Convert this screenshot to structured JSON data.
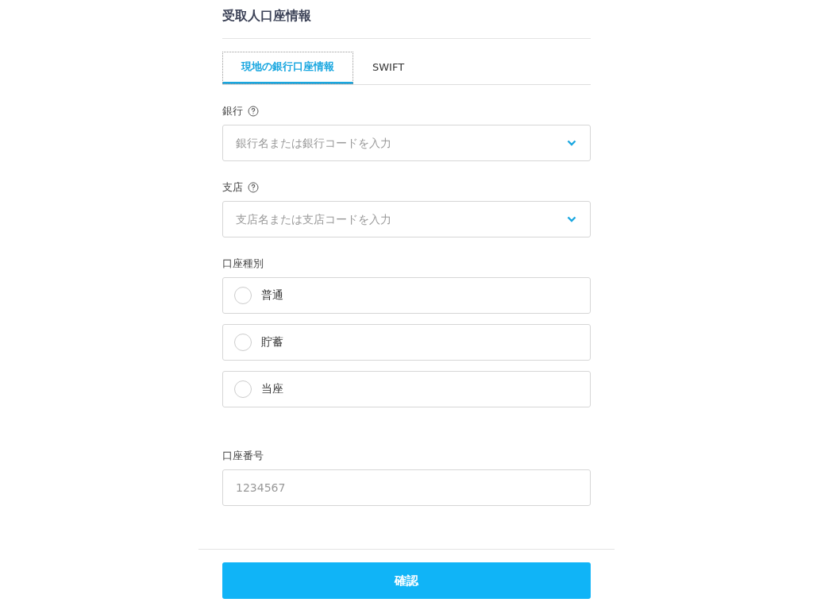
{
  "title": "受取人口座情報",
  "tabs": [
    {
      "label": "現地の銀行口座情報",
      "selected": true
    },
    {
      "label": "SWIFT",
      "selected": false
    }
  ],
  "bank": {
    "label": "銀行",
    "help": true,
    "placeholder": "銀行名または銀行コードを入力"
  },
  "branch": {
    "label": "支店",
    "help": true,
    "placeholder": "支店名または支店コードを入力"
  },
  "account_type": {
    "label": "口座種別",
    "options": [
      {
        "label": "普通",
        "selected": false
      },
      {
        "label": "貯蓄",
        "selected": false
      },
      {
        "label": "当座",
        "selected": false
      }
    ]
  },
  "account_number": {
    "label": "口座番号",
    "placeholder": "1234567"
  },
  "confirm_button": "確認"
}
